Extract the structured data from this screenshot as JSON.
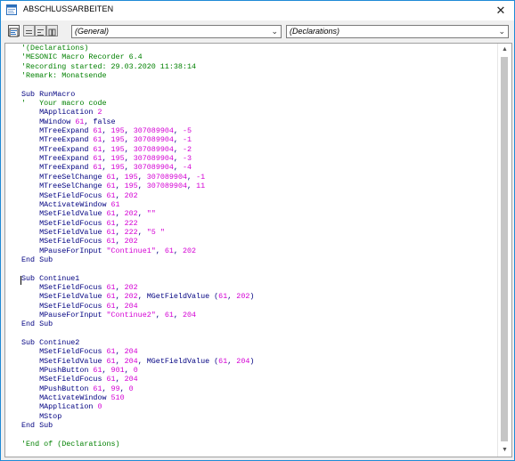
{
  "window": {
    "title": "ABSCHLUSSARBEITEN",
    "close_glyph": "✕"
  },
  "toolbar": {
    "object_combo": "(General)",
    "proc_combo": "(Declarations)",
    "combo_arrow": "⌄",
    "buttons": [
      "view-code-icon",
      "full-module-view-icon",
      "procedure-view-icon",
      "split-view-icon"
    ]
  },
  "editor": {
    "scroll_up": "▲",
    "scroll_down": "▼",
    "colors": {
      "comment": "#008000",
      "keyword": "#000080",
      "number": "#d400d4"
    },
    "lines": [
      [
        [
          "c",
          "'(Declarations)"
        ]
      ],
      [
        [
          "c",
          "'MESONIC Macro Recorder 6.4"
        ]
      ],
      [
        [
          "c",
          "'Recording started: 29.03.2020 11:38:14"
        ]
      ],
      [
        [
          "c",
          "'Remark: Monatsende"
        ]
      ],
      [],
      [
        [
          "k",
          "Sub RunMacro"
        ]
      ],
      [
        [
          "c",
          "'   Your macro code"
        ]
      ],
      [
        [
          "k",
          "    MApplication "
        ],
        [
          "n",
          "2"
        ]
      ],
      [
        [
          "k",
          "    MWindow "
        ],
        [
          "n",
          "61"
        ],
        [
          "k",
          ", false"
        ]
      ],
      [
        [
          "k",
          "    MTreeExpand "
        ],
        [
          "n",
          "61"
        ],
        [
          "k",
          ", "
        ],
        [
          "n",
          "195"
        ],
        [
          "k",
          ", "
        ],
        [
          "n",
          "307089904"
        ],
        [
          "k",
          ", "
        ],
        [
          "n",
          "-5"
        ]
      ],
      [
        [
          "k",
          "    MTreeExpand "
        ],
        [
          "n",
          "61"
        ],
        [
          "k",
          ", "
        ],
        [
          "n",
          "195"
        ],
        [
          "k",
          ", "
        ],
        [
          "n",
          "307089904"
        ],
        [
          "k",
          ", "
        ],
        [
          "n",
          "-1"
        ]
      ],
      [
        [
          "k",
          "    MTreeExpand "
        ],
        [
          "n",
          "61"
        ],
        [
          "k",
          ", "
        ],
        [
          "n",
          "195"
        ],
        [
          "k",
          ", "
        ],
        [
          "n",
          "307089904"
        ],
        [
          "k",
          ", "
        ],
        [
          "n",
          "-2"
        ]
      ],
      [
        [
          "k",
          "    MTreeExpand "
        ],
        [
          "n",
          "61"
        ],
        [
          "k",
          ", "
        ],
        [
          "n",
          "195"
        ],
        [
          "k",
          ", "
        ],
        [
          "n",
          "307089904"
        ],
        [
          "k",
          ", "
        ],
        [
          "n",
          "-3"
        ]
      ],
      [
        [
          "k",
          "    MTreeExpand "
        ],
        [
          "n",
          "61"
        ],
        [
          "k",
          ", "
        ],
        [
          "n",
          "195"
        ],
        [
          "k",
          ", "
        ],
        [
          "n",
          "307089904"
        ],
        [
          "k",
          ", "
        ],
        [
          "n",
          "-4"
        ]
      ],
      [
        [
          "k",
          "    MTreeSelChange "
        ],
        [
          "n",
          "61"
        ],
        [
          "k",
          ", "
        ],
        [
          "n",
          "195"
        ],
        [
          "k",
          ", "
        ],
        [
          "n",
          "307089904"
        ],
        [
          "k",
          ", "
        ],
        [
          "n",
          "-1"
        ]
      ],
      [
        [
          "k",
          "    MTreeSelChange "
        ],
        [
          "n",
          "61"
        ],
        [
          "k",
          ", "
        ],
        [
          "n",
          "195"
        ],
        [
          "k",
          ", "
        ],
        [
          "n",
          "307089904"
        ],
        [
          "k",
          ", "
        ],
        [
          "n",
          "11"
        ]
      ],
      [
        [
          "k",
          "    MSetFieldFocus "
        ],
        [
          "n",
          "61"
        ],
        [
          "k",
          ", "
        ],
        [
          "n",
          "202"
        ]
      ],
      [
        [
          "k",
          "    MActivateWindow "
        ],
        [
          "n",
          "61"
        ]
      ],
      [
        [
          "k",
          "    MSetFieldValue "
        ],
        [
          "n",
          "61"
        ],
        [
          "k",
          ", "
        ],
        [
          "n",
          "202"
        ],
        [
          "k",
          ", "
        ],
        [
          "n",
          "\"\""
        ]
      ],
      [
        [
          "k",
          "    MSetFieldFocus "
        ],
        [
          "n",
          "61"
        ],
        [
          "k",
          ", "
        ],
        [
          "n",
          "222"
        ]
      ],
      [
        [
          "k",
          "    MSetFieldValue "
        ],
        [
          "n",
          "61"
        ],
        [
          "k",
          ", "
        ],
        [
          "n",
          "222"
        ],
        [
          "k",
          ", "
        ],
        [
          "n",
          "\"5 \""
        ]
      ],
      [
        [
          "k",
          "    MSetFieldFocus "
        ],
        [
          "n",
          "61"
        ],
        [
          "k",
          ", "
        ],
        [
          "n",
          "202"
        ]
      ],
      [
        [
          "k",
          "    MPauseForInput "
        ],
        [
          "n",
          "\"Continue1\""
        ],
        [
          "k",
          ", "
        ],
        [
          "n",
          "61"
        ],
        [
          "k",
          ", "
        ],
        [
          "n",
          "202"
        ]
      ],
      [
        [
          "k",
          "End Sub"
        ]
      ],
      [],
      [
        [
          "k",
          "Sub Continue1"
        ]
      ],
      [
        [
          "k",
          "    MSetFieldFocus "
        ],
        [
          "n",
          "61"
        ],
        [
          "k",
          ", "
        ],
        [
          "n",
          "202"
        ]
      ],
      [
        [
          "k",
          "    MSetFieldValue "
        ],
        [
          "n",
          "61"
        ],
        [
          "k",
          ", "
        ],
        [
          "n",
          "202"
        ],
        [
          "k",
          ", MGetFieldValue ("
        ],
        [
          "n",
          "61"
        ],
        [
          "k",
          ", "
        ],
        [
          "n",
          "202"
        ],
        [
          "k",
          ")"
        ]
      ],
      [
        [
          "k",
          "    MSetFieldFocus "
        ],
        [
          "n",
          "61"
        ],
        [
          "k",
          ", "
        ],
        [
          "n",
          "204"
        ]
      ],
      [
        [
          "k",
          "    MPauseForInput "
        ],
        [
          "n",
          "\"Continue2\""
        ],
        [
          "k",
          ", "
        ],
        [
          "n",
          "61"
        ],
        [
          "k",
          ", "
        ],
        [
          "n",
          "204"
        ]
      ],
      [
        [
          "k",
          "End Sub"
        ]
      ],
      [],
      [
        [
          "k",
          "Sub Continue2"
        ]
      ],
      [
        [
          "k",
          "    MSetFieldFocus "
        ],
        [
          "n",
          "61"
        ],
        [
          "k",
          ", "
        ],
        [
          "n",
          "204"
        ]
      ],
      [
        [
          "k",
          "    MSetFieldValue "
        ],
        [
          "n",
          "61"
        ],
        [
          "k",
          ", "
        ],
        [
          "n",
          "204"
        ],
        [
          "k",
          ", MGetFieldValue ("
        ],
        [
          "n",
          "61"
        ],
        [
          "k",
          ", "
        ],
        [
          "n",
          "204"
        ],
        [
          "k",
          ")"
        ]
      ],
      [
        [
          "k",
          "    MPushButton "
        ],
        [
          "n",
          "61"
        ],
        [
          "k",
          ", "
        ],
        [
          "n",
          "901"
        ],
        [
          "k",
          ", "
        ],
        [
          "n",
          "0"
        ]
      ],
      [
        [
          "k",
          "    MSetFieldFocus "
        ],
        [
          "n",
          "61"
        ],
        [
          "k",
          ", "
        ],
        [
          "n",
          "204"
        ]
      ],
      [
        [
          "k",
          "    MPushButton "
        ],
        [
          "n",
          "61"
        ],
        [
          "k",
          ", "
        ],
        [
          "n",
          "99"
        ],
        [
          "k",
          ", "
        ],
        [
          "n",
          "0"
        ]
      ],
      [
        [
          "k",
          "    MActivateWindow "
        ],
        [
          "n",
          "510"
        ]
      ],
      [
        [
          "k",
          "    MApplication "
        ],
        [
          "n",
          "0"
        ]
      ],
      [
        [
          "k",
          "    MStop"
        ]
      ],
      [
        [
          "k",
          "End Sub"
        ]
      ],
      [],
      [
        [
          "c",
          "'End of (Declarations)"
        ]
      ]
    ]
  }
}
